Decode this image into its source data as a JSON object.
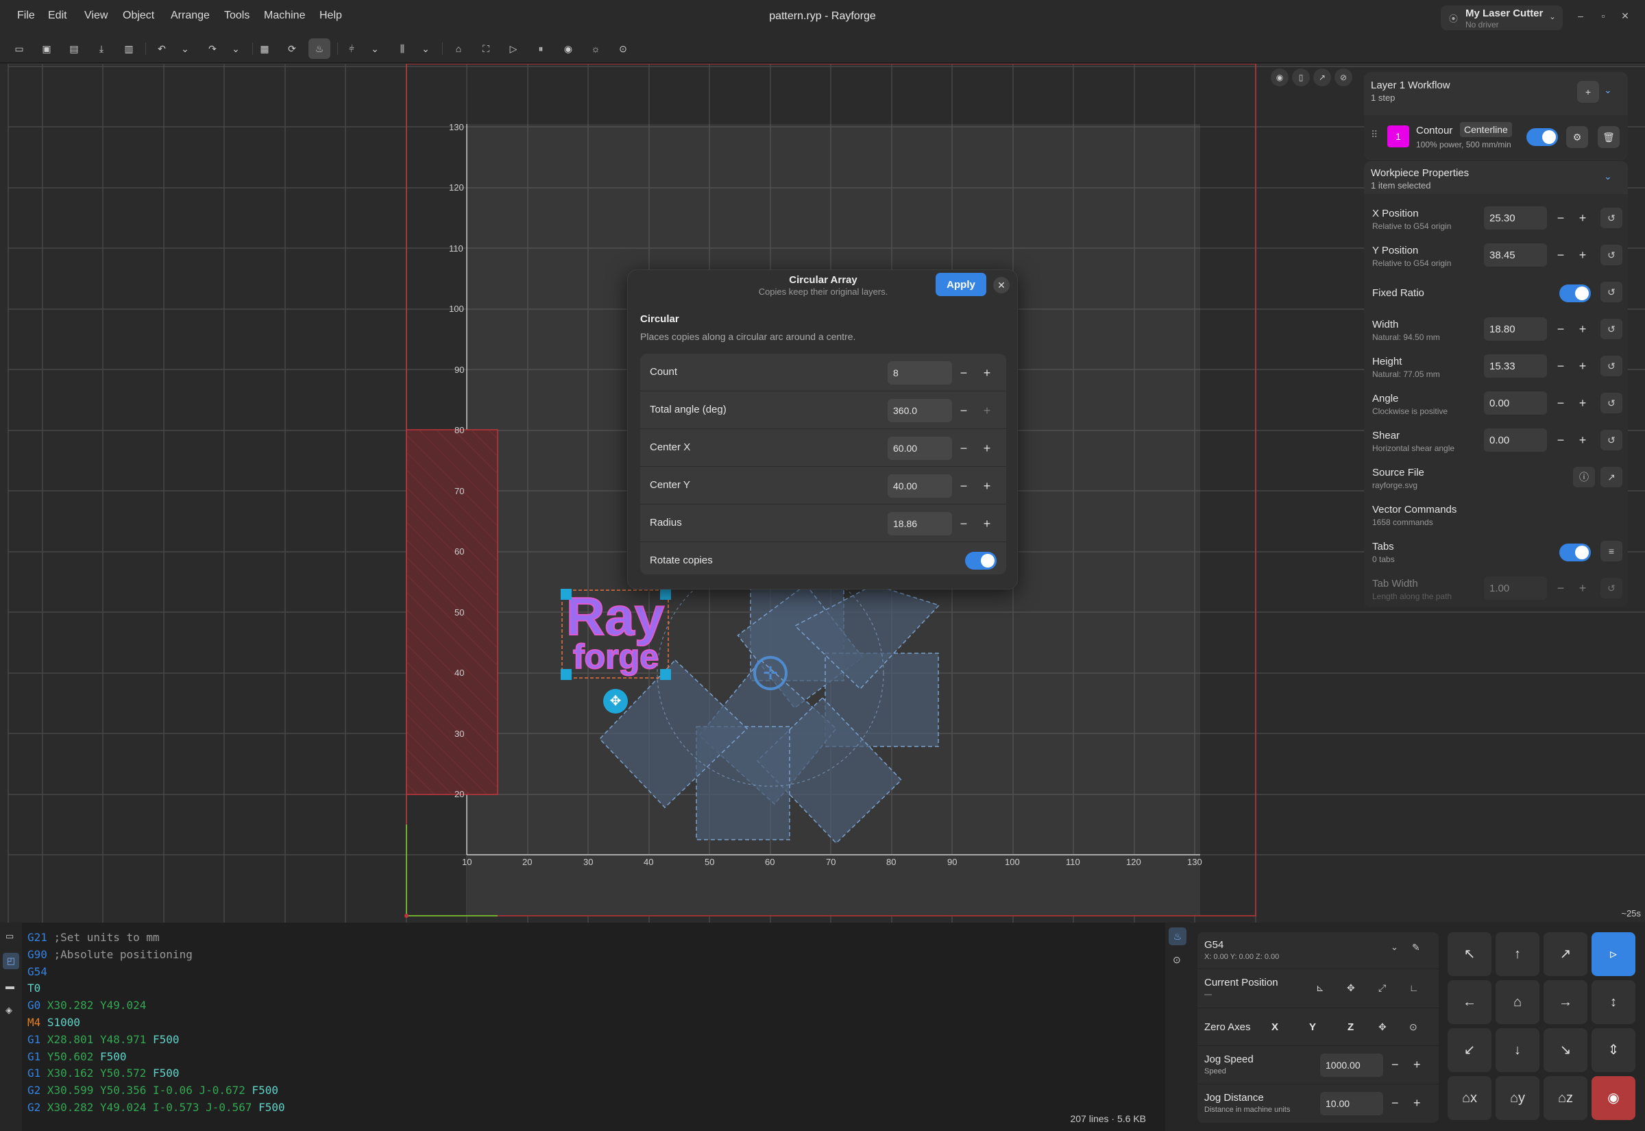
{
  "menu": [
    "File",
    "Edit",
    "View",
    "Object",
    "Arrange",
    "Tools",
    "Machine",
    "Help"
  ],
  "window_title": "pattern.ryp - Rayforge",
  "machine": {
    "name": "My Laser Cutter",
    "driver": "No driver"
  },
  "window_controls": [
    "chevron-down-icon",
    "minimize-icon",
    "maximize-icon",
    "close-icon"
  ],
  "toolbar_icons": [
    "open-file-icon",
    "save-icon",
    "save-as-icon",
    "import-icon",
    "export-icon",
    "undo-icon",
    "undo-dropdown-icon",
    "redo-icon",
    "redo-dropdown-icon",
    "simulate-icon",
    "refresh-icon",
    "laser-icon",
    "align-icon",
    "align-dropdown-icon",
    "distribute-icon",
    "distribute-dropdown-icon",
    "home-icon",
    "frame-icon",
    "play-icon",
    "pause-icon",
    "record-icon",
    "light-icon",
    "focus-icon"
  ],
  "canvas": {
    "x_ticks": [
      "10",
      "20",
      "30",
      "40",
      "50",
      "60",
      "70",
      "80",
      "90",
      "100",
      "110",
      "120",
      "130"
    ],
    "y_ticks": [
      "130",
      "120",
      "110",
      "100",
      "90",
      "80",
      "70",
      "60",
      "50",
      "40",
      "30",
      "20"
    ],
    "logo_text_top": "Ray",
    "logo_text_bottom": "forge",
    "time_estimate": "~25s"
  },
  "dialog": {
    "title": "Circular Array",
    "subtitle": "Copies keep their original layers.",
    "apply_label": "Apply",
    "section_title": "Circular",
    "section_desc": "Places copies along a circular arc around a centre.",
    "rows": [
      {
        "label": "Count",
        "value": "8"
      },
      {
        "label": "Total angle (deg)",
        "value": "360.0"
      },
      {
        "label": "Center X",
        "value": "60.00"
      },
      {
        "label": "Center Y",
        "value": "40.00"
      },
      {
        "label": "Radius",
        "value": "18.86"
      }
    ],
    "rotate_label": "Rotate copies",
    "rotate_on": true
  },
  "workflow": {
    "title": "Layer 1 Workflow",
    "subtitle": "1 step",
    "step_number": "1",
    "step_name": "Contour",
    "step_tag": "Centerline",
    "step_desc": "100% power, 500 mm/min",
    "step_color": "#e800e8"
  },
  "properties": {
    "title": "Workpiece Properties",
    "subtitle": "1 item selected",
    "rows": [
      {
        "label": "X Position",
        "desc": "Relative to G54 origin",
        "value": "25.30"
      },
      {
        "label": "Y Position",
        "desc": "Relative to G54 origin",
        "value": "38.45"
      },
      {
        "label": "Width",
        "desc": "Natural: 94.50 mm",
        "value": "18.80"
      },
      {
        "label": "Height",
        "desc": "Natural: 77.05 mm",
        "value": "15.33"
      },
      {
        "label": "Angle",
        "desc": "Clockwise is positive",
        "value": "0.00"
      },
      {
        "label": "Shear",
        "desc": "Horizontal shear angle",
        "value": "0.00"
      }
    ],
    "fixed_ratio": "Fixed Ratio",
    "source_file": {
      "label": "Source File",
      "value": "rayforge.svg"
    },
    "vector": {
      "label": "Vector Commands",
      "value": "1658 commands"
    },
    "tabs": {
      "label": "Tabs",
      "value": "0 tabs"
    },
    "tab_width": {
      "label": "Tab Width",
      "desc": "Length along the path",
      "value": "1.00"
    }
  },
  "gcode": {
    "lines": [
      [
        [
          "G21",
          "#3584e4"
        ],
        [
          " ;Set units to mm",
          "#9a9a9a"
        ]
      ],
      [
        [
          "G90",
          "#3584e4"
        ],
        [
          " ;Absolute positioning",
          "#9a9a9a"
        ]
      ],
      [
        [
          "G54",
          "#3584e4"
        ]
      ],
      [
        [
          "T0",
          "#5fd3c8"
        ]
      ],
      [
        [
          "G0",
          "#3584e4"
        ],
        [
          " X30.282 Y49.024",
          "#33a853"
        ]
      ],
      [
        [
          "M4",
          "#e67e22"
        ],
        [
          " S1000",
          "#5fd3c8"
        ]
      ],
      [
        [
          "G1",
          "#3584e4"
        ],
        [
          " X28.801 Y48.971",
          "#33a853"
        ],
        [
          " F500",
          "#5fd3c8"
        ]
      ],
      [
        [
          "G1",
          "#3584e4"
        ],
        [
          " Y50.602",
          "#33a853"
        ],
        [
          " F500",
          "#5fd3c8"
        ]
      ],
      [
        [
          "G1",
          "#3584e4"
        ],
        [
          " X30.162 Y50.572",
          "#33a853"
        ],
        [
          " F500",
          "#5fd3c8"
        ]
      ],
      [
        [
          "G2",
          "#3584e4"
        ],
        [
          " X30.599 Y50.356 I-0.06 J-0.672",
          "#33a853"
        ],
        [
          " F500",
          "#5fd3c8"
        ]
      ],
      [
        [
          "G2",
          "#3584e4"
        ],
        [
          " X30.282 Y49.024 I-0.573 J-0.567",
          "#33a853"
        ],
        [
          " F500",
          "#5fd3c8"
        ]
      ]
    ],
    "status": "207 lines · 5.6 KB"
  },
  "control": {
    "wcs": "G54",
    "wcs_coords": "X: 0.00   Y: 0.00   Z: 0.00",
    "current_position": "Current Position",
    "current_position_value": "—",
    "zero_axes": "Zero Axes",
    "axes": [
      "X",
      "Y",
      "Z"
    ],
    "jog_speed": {
      "label": "Jog Speed",
      "desc": "Speed",
      "value": "1000.00"
    },
    "jog_distance": {
      "label": "Jog Distance",
      "desc": "Distance in machine units",
      "value": "10.00"
    }
  }
}
